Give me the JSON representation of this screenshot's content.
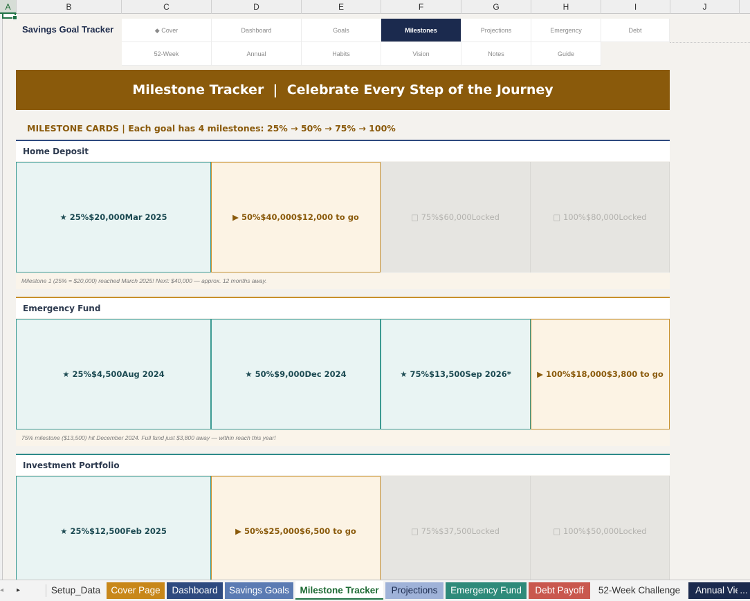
{
  "columns": [
    "A",
    "B",
    "C",
    "D",
    "E",
    "F",
    "G",
    "H",
    "I",
    "J"
  ],
  "brand": "Savings Goal Tracker",
  "nav_row1": [
    {
      "label": "◆ Cover"
    },
    {
      "label": "Dashboard"
    },
    {
      "label": "Goals"
    },
    {
      "label": "Milestones",
      "active": true
    },
    {
      "label": "Projections"
    },
    {
      "label": "Emergency"
    },
    {
      "label": "Debt"
    }
  ],
  "nav_row2": [
    {
      "label": "52-Week"
    },
    {
      "label": "Annual"
    },
    {
      "label": "Habits"
    },
    {
      "label": "Vision"
    },
    {
      "label": "Notes"
    },
    {
      "label": "Guide"
    }
  ],
  "banner": "Milestone Tracker  |  Celebrate Every Step of the Journey",
  "subhead": "MILESTONE CARDS  |  Each goal has 4 milestones: 25% → 50% → 75% → 100%",
  "goals": [
    {
      "title": "Home Deposit",
      "cards": [
        {
          "text": "★ 25%$20,000Mar 2025",
          "state": "done"
        },
        {
          "text": "▶ 50%$40,000$12,000 to go",
          "state": "next"
        },
        {
          "text": "□ 75%$60,000Locked",
          "state": "locked"
        },
        {
          "text": "□ 100%$80,000Locked",
          "state": "locked"
        }
      ],
      "note": "Milestone 1 (25% = $20,000) reached March 2025! Next: $40,000 — approx. 12 months away."
    },
    {
      "title": "Emergency Fund",
      "cards": [
        {
          "text": "★ 25%$4,500Aug 2024",
          "state": "done"
        },
        {
          "text": "★ 50%$9,000Dec 2024",
          "state": "done"
        },
        {
          "text": "★ 75%$13,500Sep 2026*",
          "state": "done"
        },
        {
          "text": "▶ 100%$18,000$3,800 to go",
          "state": "next"
        }
      ],
      "note": "75% milestone ($13,500) hit December 2024. Full fund just $3,800 away — within reach this year!"
    },
    {
      "title": "Investment Portfolio",
      "cards": [
        {
          "text": "★ 25%$12,500Feb 2025",
          "state": "done"
        },
        {
          "text": "▶ 50%$25,000$6,500 to go",
          "state": "next"
        },
        {
          "text": "□ 75%$37,500Locked",
          "state": "locked"
        },
        {
          "text": "□ 100%$50,000Locked",
          "state": "locked"
        }
      ],
      "note": ""
    }
  ],
  "tabs": [
    {
      "label": "Setup_Data",
      "color": ""
    },
    {
      "label": "Cover Page",
      "color": "#c8871a"
    },
    {
      "label": "Dashboard",
      "color": "#2e4a7f"
    },
    {
      "label": "Savings Goals",
      "color": "#5b7bb3"
    },
    {
      "label": "Milestone Tracker",
      "color": "",
      "active": true
    },
    {
      "label": "Projections",
      "color": "#9fb2d8"
    },
    {
      "label": "Emergency Fund",
      "color": "#2e8a7a"
    },
    {
      "label": "Debt Payoff",
      "color": "#c9584e"
    },
    {
      "label": "52-Week Challenge",
      "color": ""
    },
    {
      "label": "Annual Vie",
      "color": "#1b2a4e"
    }
  ],
  "tabs_more": "..."
}
